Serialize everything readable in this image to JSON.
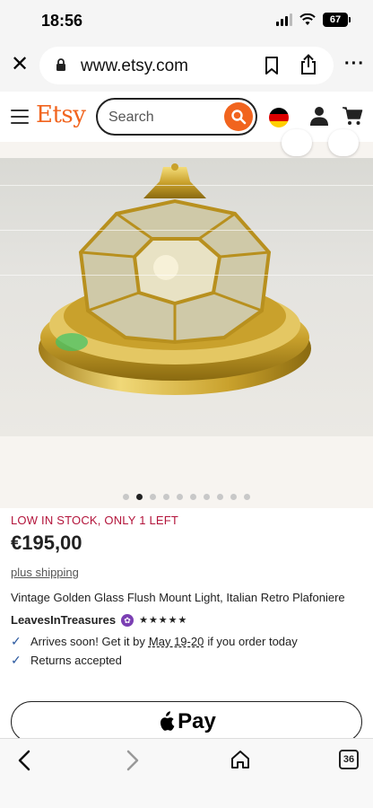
{
  "status_bar": {
    "time": "18:56",
    "battery": "67"
  },
  "browser": {
    "url": "www.etsy.com"
  },
  "etsy_header": {
    "logo": "Etsy",
    "search_placeholder": "Search"
  },
  "carousel": {
    "count": 10,
    "active_index": 1
  },
  "product": {
    "stock_label": "LOW IN STOCK, ONLY 1 LEFT",
    "price": "€195,00",
    "shipping": "plus shipping",
    "title": "Vintage Golden Glass Flush Mount Light, Italian Retro Plafoniere",
    "seller": "LeavesInTreasures",
    "stars": "★★★★★",
    "arrival_prefix": "Arrives soon! Get it by",
    "arrival_dates": "May 19-20",
    "arrival_suffix": "if you order today",
    "returns": "Returns accepted"
  },
  "applepay": {
    "label": "Pay"
  },
  "toolbar": {
    "tab_count": "36"
  },
  "colors": {
    "etsy_orange": "#f1641e",
    "stock_red": "#b3143b",
    "check_blue": "#2c5aa0",
    "badge_purple": "#7b3fb3"
  }
}
